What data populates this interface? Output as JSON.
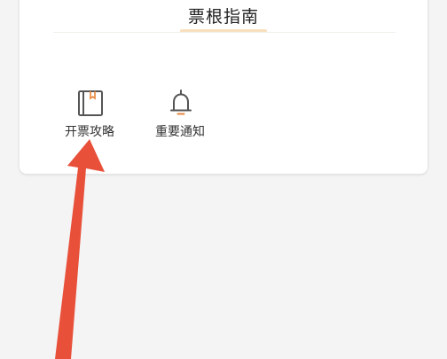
{
  "card": {
    "title": "票根指南"
  },
  "shortcuts": [
    {
      "label": "开票攻略",
      "icon": "book-icon"
    },
    {
      "label": "重要通知",
      "icon": "bell-icon"
    }
  ],
  "colors": {
    "accent_underline": "#f8e0be",
    "arrow": "#e8503a",
    "background": "#f4f4f4",
    "card": "#ffffff"
  }
}
